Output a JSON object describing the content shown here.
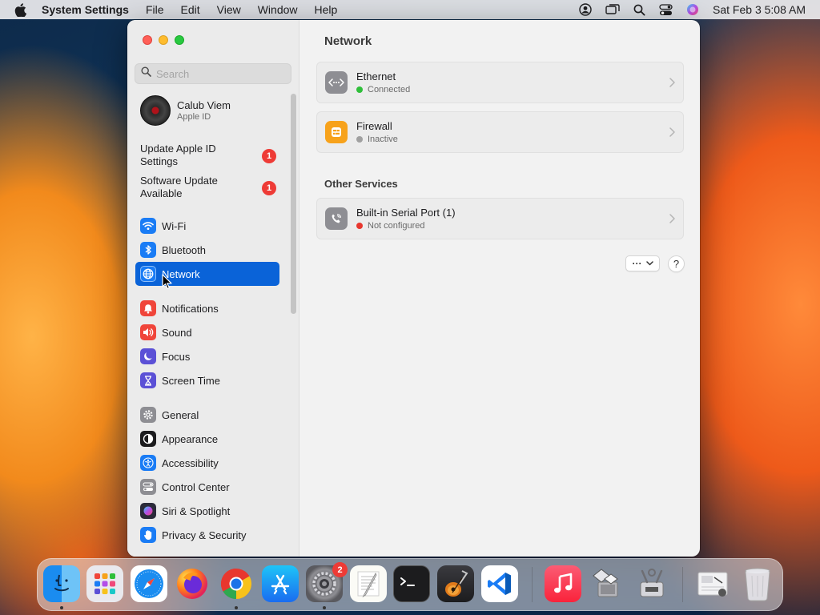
{
  "menubar": {
    "app_name": "System Settings",
    "items": [
      "File",
      "Edit",
      "View",
      "Window",
      "Help"
    ],
    "clock": "Sat Feb 3  5:08 AM"
  },
  "sidebar": {
    "search_placeholder": "Search",
    "profile": {
      "name": "Calub Viem",
      "subtitle": "Apple ID"
    },
    "notices": [
      {
        "label": "Update Apple ID Settings",
        "count": "1"
      },
      {
        "label": "Software Update Available",
        "count": "1"
      }
    ],
    "items": [
      {
        "label": "Wi-Fi",
        "icon": "wifi-icon",
        "color": "#1a7cf5"
      },
      {
        "label": "Bluetooth",
        "icon": "bluetooth-icon",
        "color": "#1a7cf5"
      },
      {
        "label": "Network",
        "icon": "globe-icon",
        "color": "#1a7cf5",
        "selected": true
      },
      {
        "label": "Notifications",
        "icon": "bell-icon",
        "color": "#f0453a"
      },
      {
        "label": "Sound",
        "icon": "speaker-icon",
        "color": "#f0453a"
      },
      {
        "label": "Focus",
        "icon": "moon-icon",
        "color": "#5b50d6"
      },
      {
        "label": "Screen Time",
        "icon": "hourglass-icon",
        "color": "#5b50d6"
      },
      {
        "label": "General",
        "icon": "gear-icon",
        "color": "#8e8e93"
      },
      {
        "label": "Appearance",
        "icon": "appearance-icon",
        "color": "#1c1c1e"
      },
      {
        "label": "Accessibility",
        "icon": "accessibility-icon",
        "color": "#1a7cf5"
      },
      {
        "label": "Control Center",
        "icon": "control-center-icon",
        "color": "#8e8e93"
      },
      {
        "label": "Siri & Spotlight",
        "icon": "siri-icon",
        "color": "#2b2b3a"
      },
      {
        "label": "Privacy & Security",
        "icon": "hand-icon",
        "color": "#1a7cf5"
      }
    ]
  },
  "main": {
    "title": "Network",
    "services": [
      {
        "name": "Ethernet",
        "status": "Connected",
        "status_color": "#2fbf3a",
        "icon": "ethernet-icon"
      },
      {
        "name": "Firewall",
        "status": "Inactive",
        "status_color": "#a0a0a0",
        "icon": "firewall-icon"
      }
    ],
    "other_title": "Other Services",
    "other_services": [
      {
        "name": "Built-in Serial Port (1)",
        "status": "Not configured",
        "status_color": "#e8372e",
        "icon": "phone-icon"
      }
    ],
    "more_label": "···",
    "help_label": "?"
  },
  "dock": {
    "settings_badge": "2",
    "apps": [
      "finder-icon",
      "launchpad-icon",
      "safari-icon",
      "firefox-icon",
      "chrome-icon",
      "app-store-icon",
      "system-settings-icon",
      "textedit-icon",
      "terminal-icon",
      "garageband-icon",
      "vscode-icon",
      "music-icon",
      "migration-icon",
      "disk-utility-icon",
      "preview-icon",
      "trash-icon"
    ]
  }
}
